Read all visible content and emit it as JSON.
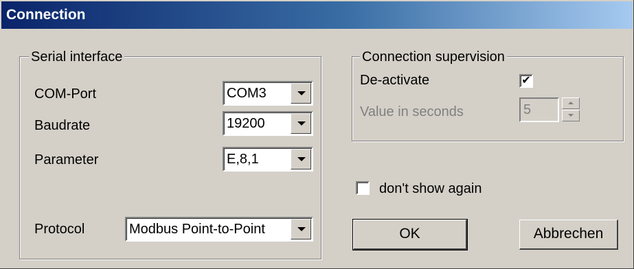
{
  "window": {
    "title": "Connection"
  },
  "serial": {
    "legend": "Serial interface",
    "com_port": {
      "label": "COM-Port",
      "value": "COM3"
    },
    "baudrate": {
      "label": "Baudrate",
      "value": "19200"
    },
    "parameter": {
      "label": "Parameter",
      "value": "E,8,1"
    },
    "protocol": {
      "label": "Protocol",
      "value": "Modbus Point-to-Point"
    }
  },
  "supervision": {
    "legend": "Connection supervision",
    "deactivate": {
      "label": "De-activate",
      "checked": true,
      "mark": "✔"
    },
    "seconds": {
      "label": "Value in seconds",
      "value": "5"
    }
  },
  "dont_show": {
    "label": "don't show again",
    "checked": false
  },
  "buttons": {
    "ok": "OK",
    "cancel": "Abbrechen"
  }
}
